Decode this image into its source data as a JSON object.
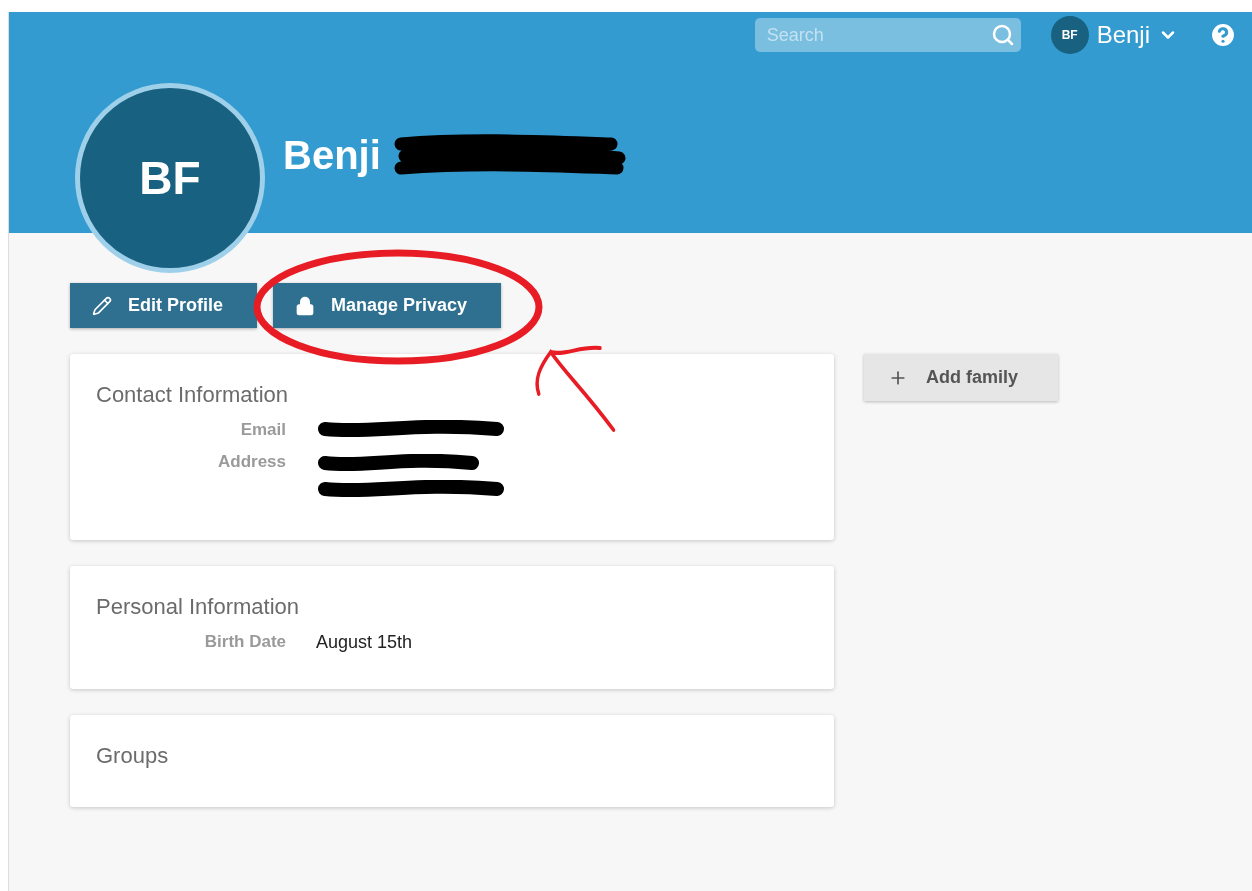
{
  "header": {
    "search": {
      "placeholder": "Search"
    },
    "user": {
      "initials": "BF",
      "name": "Benji"
    }
  },
  "profile": {
    "initials": "BF",
    "name": "Benji",
    "name_redacted": true
  },
  "actions": [
    {
      "label": "Edit Profile",
      "kind": "edit"
    },
    {
      "label": "Manage Privacy",
      "kind": "privacy"
    }
  ],
  "cards": [
    {
      "title": "Contact Information",
      "fields": [
        {
          "label": "Email",
          "kind": "redacted"
        },
        {
          "label": "Address",
          "kind": "redacted_multi"
        }
      ]
    },
    {
      "title": "Personal Information",
      "fields": [
        {
          "label": "Birth Date",
          "kind": "text",
          "value": "August 15th"
        }
      ]
    },
    {
      "title": "Groups"
    }
  ],
  "side_button": {
    "label": "Add family"
  },
  "annotations": {
    "circle": true,
    "arrow": true
  }
}
